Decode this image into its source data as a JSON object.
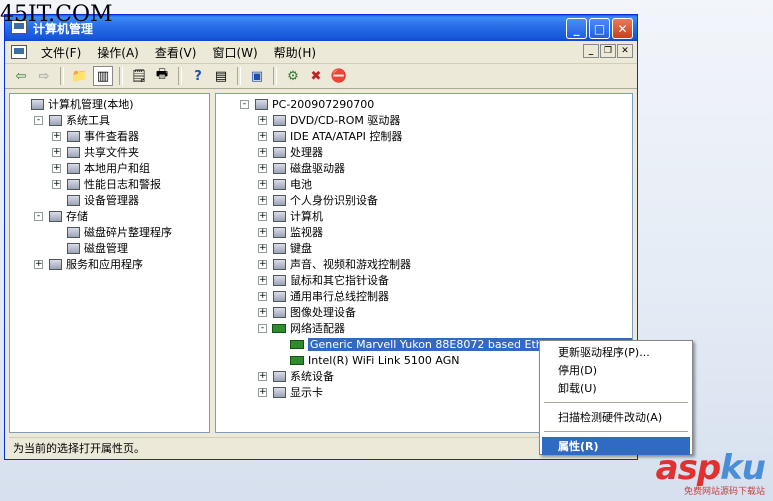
{
  "watermark_top": "45IT.COM",
  "watermark_bottom": {
    "logo_a": "asp",
    "logo_b": "ku",
    "sub": "免费网站源码下载站"
  },
  "window": {
    "title": "计算机管理"
  },
  "menu": [
    "文件(F)",
    "操作(A)",
    "查看(V)",
    "窗口(W)",
    "帮助(H)"
  ],
  "toolbar_icons": [
    "back-icon",
    "forward-icon",
    "up-folder-icon",
    "show-hide-tree-icon",
    "properties-icon",
    "print-icon",
    "help-icon",
    "help-topics-icon",
    "scan-hardware-icon",
    "update-driver-icon",
    "uninstall-icon",
    "disable-icon"
  ],
  "left_tree": [
    {
      "label": "计算机管理(本地)",
      "exp": "",
      "indent": 0,
      "icon": "computer-management-icon"
    },
    {
      "label": "系统工具",
      "exp": "-",
      "indent": 1,
      "icon": "system-tools-icon"
    },
    {
      "label": "事件查看器",
      "exp": "+",
      "indent": 2,
      "icon": "event-viewer-icon"
    },
    {
      "label": "共享文件夹",
      "exp": "+",
      "indent": 2,
      "icon": "shared-folders-icon"
    },
    {
      "label": "本地用户和组",
      "exp": "+",
      "indent": 2,
      "icon": "local-users-icon"
    },
    {
      "label": "性能日志和警报",
      "exp": "+",
      "indent": 2,
      "icon": "performance-logs-icon"
    },
    {
      "label": "设备管理器",
      "exp": "",
      "indent": 2,
      "icon": "device-manager-icon"
    },
    {
      "label": "存储",
      "exp": "-",
      "indent": 1,
      "icon": "storage-icon"
    },
    {
      "label": "磁盘碎片整理程序",
      "exp": "",
      "indent": 2,
      "icon": "defragmenter-icon"
    },
    {
      "label": "磁盘管理",
      "exp": "",
      "indent": 2,
      "icon": "disk-management-icon"
    },
    {
      "label": "服务和应用程序",
      "exp": "+",
      "indent": 1,
      "icon": "services-apps-icon"
    }
  ],
  "right_tree": [
    {
      "label": "PC-200907290700",
      "exp": "-",
      "indent": 0,
      "icon": "computer-icon"
    },
    {
      "label": "DVD/CD-ROM 驱动器",
      "exp": "+",
      "indent": 1,
      "icon": "dvd-drive-icon"
    },
    {
      "label": "IDE ATA/ATAPI 控制器",
      "exp": "+",
      "indent": 1,
      "icon": "ide-controller-icon"
    },
    {
      "label": "处理器",
      "exp": "+",
      "indent": 1,
      "icon": "processor-icon"
    },
    {
      "label": "磁盘驱动器",
      "exp": "+",
      "indent": 1,
      "icon": "disk-drive-icon"
    },
    {
      "label": "电池",
      "exp": "+",
      "indent": 1,
      "icon": "battery-icon"
    },
    {
      "label": "个人身份识别设备",
      "exp": "+",
      "indent": 1,
      "icon": "identity-device-icon"
    },
    {
      "label": "计算机",
      "exp": "+",
      "indent": 1,
      "icon": "computer-icon"
    },
    {
      "label": "监视器",
      "exp": "+",
      "indent": 1,
      "icon": "monitor-icon"
    },
    {
      "label": "键盘",
      "exp": "+",
      "indent": 1,
      "icon": "keyboard-icon"
    },
    {
      "label": "声音、视频和游戏控制器",
      "exp": "+",
      "indent": 1,
      "icon": "sound-icon"
    },
    {
      "label": "鼠标和其它指针设备",
      "exp": "+",
      "indent": 1,
      "icon": "mouse-icon"
    },
    {
      "label": "通用串行总线控制器",
      "exp": "+",
      "indent": 1,
      "icon": "usb-icon"
    },
    {
      "label": "图像处理设备",
      "exp": "+",
      "indent": 1,
      "icon": "imaging-device-icon"
    },
    {
      "label": "网络适配器",
      "exp": "-",
      "indent": 1,
      "icon": "network-adapter-icon"
    },
    {
      "label": "Generic Marvell Yukon 88E8072 based Ethernet Controller",
      "exp": "",
      "indent": 2,
      "icon": "network-card-icon",
      "selected": true
    },
    {
      "label": "Intel(R) WiFi Link 5100 AGN",
      "exp": "",
      "indent": 2,
      "icon": "network-card-icon"
    },
    {
      "label": "系统设备",
      "exp": "+",
      "indent": 1,
      "icon": "system-devices-icon"
    },
    {
      "label": "显示卡",
      "exp": "+",
      "indent": 1,
      "icon": "display-adapter-icon"
    }
  ],
  "status": "为当前的选择打开属性页。",
  "context_menu": {
    "items": [
      "更新驱动程序(P)...",
      "停用(D)",
      "卸载(U)",
      "扫描检测硬件改动(A)",
      "属性(R)"
    ]
  }
}
